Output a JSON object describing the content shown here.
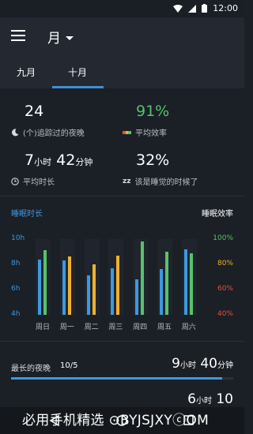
{
  "status": {
    "time": "12:00"
  },
  "header": {
    "period_label": "月"
  },
  "tabs": [
    {
      "label": "九月"
    },
    {
      "label": "十月"
    }
  ],
  "stats": {
    "nights_value": "24",
    "nights_label": "(个)追踪过的夜晚",
    "efficiency_value": "91%",
    "efficiency_label": "平均效率",
    "avg_hours": "7",
    "avg_hours_unit": "小时",
    "avg_minutes": "42",
    "avg_minutes_unit": "分钟",
    "avg_label": "平均时长",
    "bedtime_value": "32%",
    "bedtime_label": "该是睡觉的时候了"
  },
  "chart_labels": {
    "left_title": "睡眠时长",
    "right_title": "睡眠效率"
  },
  "chart_data": {
    "type": "bar",
    "categories": [
      "周日",
      "周一",
      "周二",
      "周三",
      "周四",
      "周五",
      "周六"
    ],
    "left_axis": {
      "ticks": [
        "10h",
        "8h",
        "6h",
        "4h"
      ],
      "ylim": [
        4,
        10
      ]
    },
    "right_axis": {
      "ticks": [
        "100%",
        "80%",
        "60%",
        "40%"
      ],
      "ylim": [
        40,
        100
      ]
    },
    "series": [
      {
        "axis": "left",
        "color": "#3b99e0",
        "values": [
          8.4,
          8.3,
          7.1,
          7.7,
          6.8,
          7.6,
          9.2
        ]
      },
      {
        "axis": "right",
        "values": [
          91,
          86,
          80,
          87,
          98,
          90,
          89
        ],
        "colors": [
          "#57c26a",
          "#f0b12d",
          "#f0b12d",
          "#f0b12d",
          "#57c26a",
          "#57c26a",
          "#57c26a"
        ]
      }
    ],
    "grid": false
  },
  "longest": {
    "label": "最长的夜晚",
    "date": "10/5",
    "hours": "9",
    "hours_unit": "小时",
    "minutes": "40",
    "minutes_unit": "分钟",
    "fill": 0.95
  },
  "partial_row": {
    "hours": "6",
    "hours_unit": "小时",
    "minutes": "10"
  },
  "watermark": "必用手机精选 ⊙BYJSJXYⓒOM"
}
